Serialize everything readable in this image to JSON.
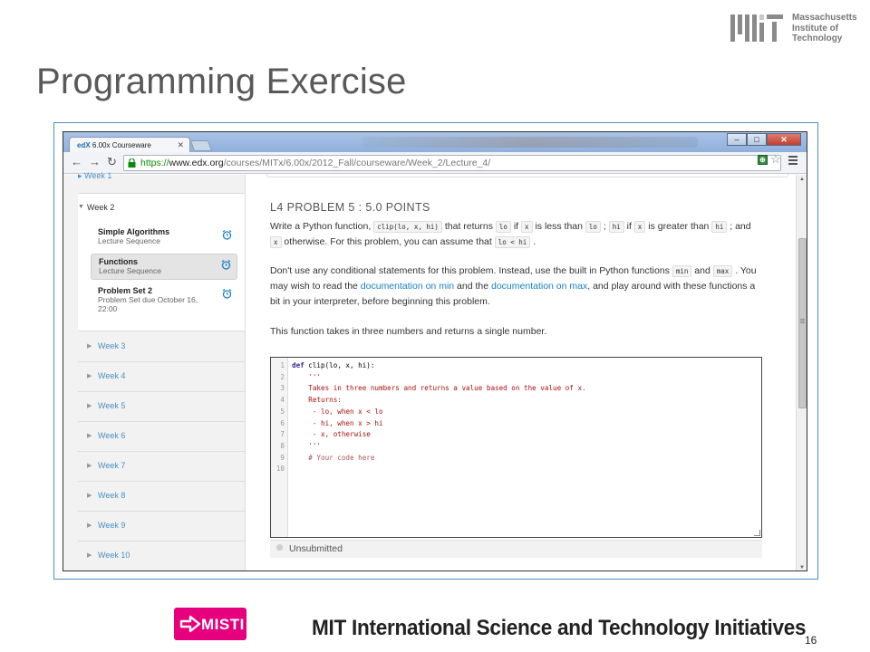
{
  "slide": {
    "title": "Programming Exercise",
    "mit_logo_lines": [
      "Massachusetts",
      "Institute of",
      "Technology"
    ],
    "misti_logo": "MISTI",
    "footer_title": "MIT International Science and Technology Initiatives",
    "page_number": "16"
  },
  "browser": {
    "tab_brand": "edX",
    "tab_title": "6.00x Courseware",
    "url_https": "https://",
    "url_host": "www.edx.org",
    "url_path": "/courses/MITx/6.00x/2012_Fall/courseware/Week_2/Lecture_4/",
    "colors": {
      "accent": "#1a80c4",
      "frame": "#4a90c2"
    }
  },
  "sidebar": {
    "open_week": "Week 2",
    "sequences": [
      {
        "title": "Simple Algorithms",
        "subtitle": "Lecture Sequence"
      },
      {
        "title": "Functions",
        "subtitle": "Lecture Sequence"
      },
      {
        "title": "Problem Set 2",
        "subtitle": "Problem Set due October 16, 22:00"
      }
    ],
    "weeks": [
      "Week 3",
      "Week 4",
      "Week 5",
      "Week 6",
      "Week 7",
      "Week 8",
      "Week 9",
      "Week 10"
    ]
  },
  "problem": {
    "title": "L4 PROBLEM 5 : 5.0 POINTS",
    "p1": {
      "t1": "Write a Python function, ",
      "c1": "clip(lo, x, hi)",
      "t2": " that returns ",
      "c2": "lo",
      "t3": " if ",
      "c3": "x",
      "t4": " is less than ",
      "c4": "lo",
      "t5": " ; ",
      "c5": "hi",
      "t6": " if ",
      "c6": "x",
      "t7": " is greater than ",
      "c7": "hi",
      "t8": " ; and ",
      "c8": "x",
      "t9": " otherwise. For this problem, you can assume that ",
      "c9": "lo < hi",
      "t10": " ."
    },
    "p2": {
      "t1": "Don't use any conditional statements for this problem. Instead, use the built in Python functions ",
      "c1": "min",
      "t2": " and ",
      "c2": "max",
      "t3": " . You may wish to read the ",
      "link1": "documentation on min",
      "t4": " and the ",
      "link2": "documentation on max",
      "t5": ", and play around with these functions a bit in your interpreter, before beginning this problem."
    },
    "p3": "This function takes in three numbers and returns a single number.",
    "code": {
      "line_numbers": [
        "1",
        "2",
        "3",
        "4",
        "5",
        "6",
        "7",
        "8",
        "9",
        "10"
      ],
      "l1_kw": "def",
      "l1_rest": " clip(lo, x, hi):",
      "l2": "    '''",
      "l3": "    Takes in three numbers and returns a value based on the value of x.",
      "l4": "    Returns:",
      "l5": "     - lo, when x < lo",
      "l6": "     - hi, when x > hi",
      "l7": "     - x, otherwise",
      "l8": "    '''",
      "l9": "    # Your code here",
      "l10": ""
    },
    "status": "Unsubmitted"
  }
}
